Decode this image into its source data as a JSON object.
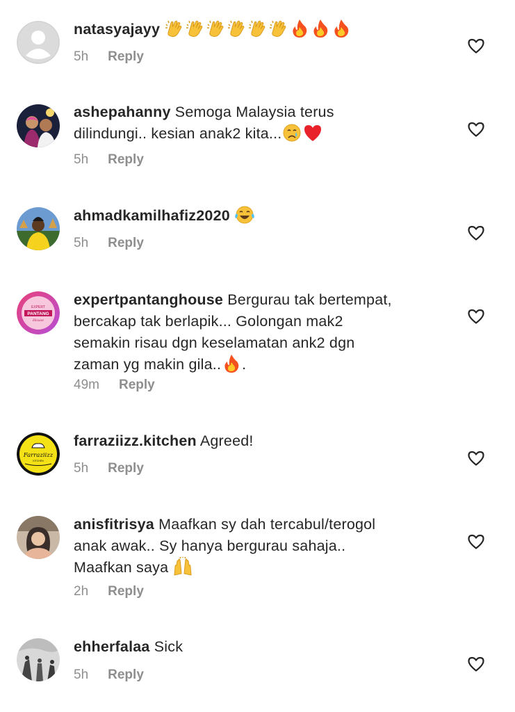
{
  "comments": [
    {
      "username": "natasyajayy",
      "text": "",
      "emojis": [
        "clapping-hands",
        "clapping-hands",
        "clapping-hands",
        "clapping-hands",
        "clapping-hands",
        "clapping-hands",
        "fire",
        "fire",
        "fire"
      ],
      "time": "5h",
      "reply": "Reply",
      "avatar": "default-avatar-icon"
    },
    {
      "username": "ashepahanny",
      "text_line1": "Semoga Malaysia terus",
      "text_line2": "dilindungi.. kesian anak2 kita...",
      "emojis": [
        "crying-face",
        "red-heart"
      ],
      "time": "5h",
      "reply": "Reply"
    },
    {
      "username": "ahmadkamilhafiz2020",
      "text": "",
      "emojis": [
        "tears-of-joy"
      ],
      "time": "5h",
      "reply": "Reply"
    },
    {
      "username": "expertpantanghouse",
      "text_line1": "Bergurau tak bertempat,",
      "text_line2": "bercakap tak berlapik... Golongan mak2",
      "text_line3": "semakin risau dgn keselamatan ank2 dgn",
      "text_line4": "zaman yg makin gila..",
      "text_line4_end": ".",
      "emojis": [
        "fire"
      ],
      "avatar_text_top": "EXPERT",
      "avatar_text_mid": "PANTANG",
      "avatar_text_bot": "House",
      "time": "49m",
      "reply": "Reply"
    },
    {
      "username": "farraziizz.kitchen",
      "text": "Agreed!",
      "avatar_text": "Farraziizz",
      "avatar_text_sub": "KITCHEN",
      "time": "5h",
      "reply": "Reply"
    },
    {
      "username": "anisfitrisya",
      "text_line1": "Maafkan sy dah tercabul/terogol",
      "text_line2": "anak awak.. Sy hanya bergurau sahaja..",
      "text_line3": "Maafkan saya",
      "emojis": [
        "raising-hands"
      ],
      "time": "2h",
      "reply": "Reply"
    },
    {
      "username": "ehherfalaa",
      "text": "Sick",
      "time": "5h",
      "reply": "Reply"
    }
  ],
  "colors": {
    "text": "#262626",
    "secondary": "#8e8e8e",
    "background": "#ffffff"
  }
}
